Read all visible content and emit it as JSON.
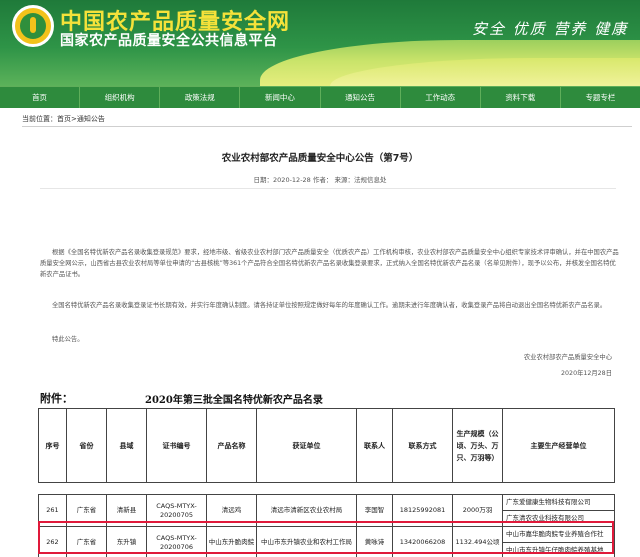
{
  "header": {
    "title": "中国农产品质量安全网",
    "subtitle": "国家农产品质量安全公共信息平台",
    "slogan": "安全 优质 营养 健康"
  },
  "nav": [
    "首页",
    "组织机构",
    "政策法规",
    "新闻中心",
    "通知公告",
    "工作动态",
    "资料下载",
    "专题专栏"
  ],
  "breadcrumb": "当前位置：首页>通知公告",
  "article": {
    "title": "农业农村部农产品质量安全中心公告（第7号）",
    "meta": "日期：2020-12-28 作者： 来源：法规信息处",
    "p1": "根据《全国名特优新农产品名录收集登录规范》要求，经地市级、省级农业农村部门农产品质量安全（优质农产品）工作机构审核，农业农村部农产品质量安全中心组织专家技术评审确认，并在中国农产品质量安全网公示，山西省古县农业农村局等单位申请的“古县核桃”等361个产品符合全国名特优新农产品名录收集登录要求，正式纳入全国名特优新农产品名录（名单见附件），现予以公布，并核发全国名特优新农产品证书。",
    "p2": "全国名特优新农产品名录收集登录证书长期有效，并实行年度确认制度。请各持证单位按照规定做好每年的年度确认工作。逾期未进行年度确认者，收集登录产品将自动退出全国名特优新农产品名录。",
    "p3": "特此公告。",
    "sign_org": "农业农村部农产品质量安全中心",
    "sign_date": "2020年12月28日"
  },
  "attachment": {
    "label": "附件：",
    "title": "2020年第三批全国名特优新农产品名录"
  },
  "table": {
    "headers": [
      "序号",
      "省份",
      "县域",
      "证书编号",
      "产品名称",
      "获证单位",
      "联系人",
      "联系方式",
      "生产规模（公顷、万头、万只、万羽等）",
      "主要生产经营单位"
    ],
    "rows": [
      {
        "no": "261",
        "province": "广东省",
        "county": "清新县",
        "cert": "CAQS-MTYX-20200705",
        "product": "清远鸡",
        "unit": "清远市清新区农业农村局",
        "contact": "李国智",
        "phone": "18125992081",
        "scale": "2000万羽",
        "producers": [
          "广东爱健康生物科技有限公司",
          "广东清农农业科技有限公司"
        ]
      },
      {
        "no": "262",
        "province": "广东省",
        "county": "东升镇",
        "cert": "CAQS-MTYX-20200706",
        "product": "中山东升脆肉鲩",
        "unit": "中山市东升镇农业和农村工作局",
        "contact": "黄咏诗",
        "phone": "13420066208",
        "scale": "1132.494公顷",
        "producers": [
          "中山市嘉华脆肉鲩专业养殖合作社",
          "中山市东升镇午仔脆肉鲩养殖基地"
        ]
      }
    ]
  }
}
